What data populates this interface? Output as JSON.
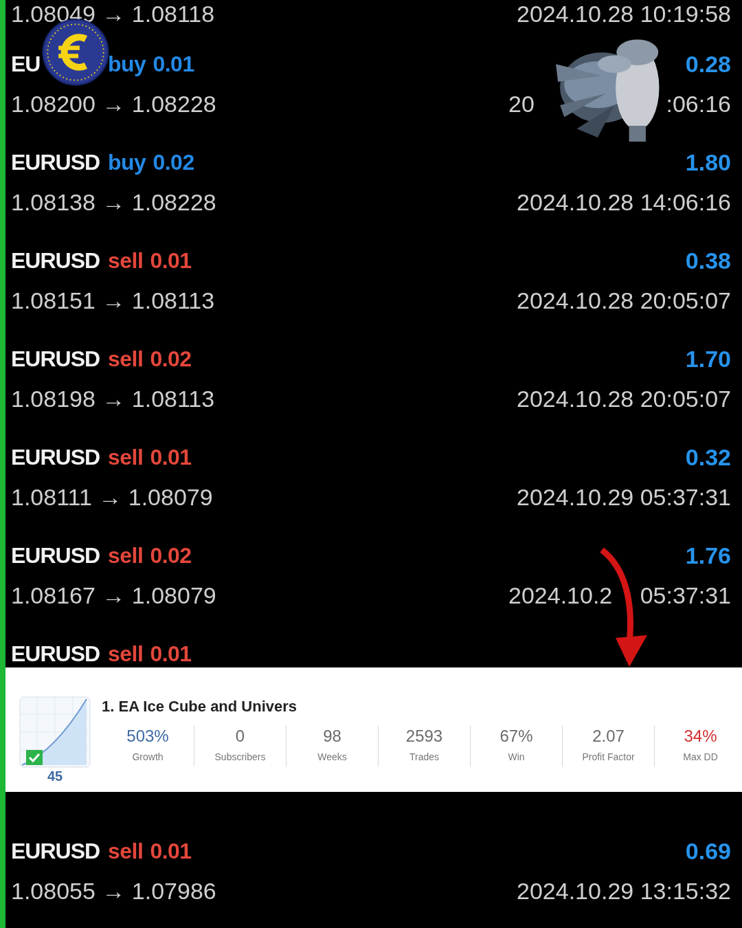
{
  "trades": [
    {
      "prices": "1.08049 → 1.08118",
      "time": [
        "2024.10.28 10:19:58"
      ]
    },
    {
      "symbol": "EU",
      "side": "buy",
      "lot": "0.01",
      "profit": "0.28",
      "prices": "1.08200 → 1.08228",
      "time": [
        "20",
        ":06:16"
      ]
    },
    {
      "symbol": "EURUSD",
      "side": "buy",
      "lot": "0.02",
      "profit": "1.80",
      "prices": "1.08138 → 1.08228",
      "time": [
        "2024.10.28 14:06:16"
      ]
    },
    {
      "symbol": "EURUSD",
      "side": "sell",
      "lot": "0.01",
      "profit": "0.38",
      "prices": "1.08151 → 1.08113",
      "time": [
        "2024.10.28 20:05:07"
      ]
    },
    {
      "symbol": "EURUSD",
      "side": "sell",
      "lot": "0.02",
      "profit": "1.70",
      "prices": "1.08198 → 1.08113",
      "time": [
        "2024.10.28 20:05:07"
      ]
    },
    {
      "symbol": "EURUSD",
      "side": "sell",
      "lot": "0.01",
      "profit": "0.32",
      "prices": "1.08111 → 1.08079",
      "time": [
        "2024.10.29 05:37:31"
      ]
    },
    {
      "symbol": "EURUSD",
      "side": "sell",
      "lot": "0.02",
      "profit": "1.76",
      "prices": "1.08167 → 1.08079",
      "time": [
        "2024.10.2",
        "05:37:31"
      ]
    },
    {
      "symbol": "EURUSD",
      "side": "sell",
      "lot": "0.01"
    }
  ],
  "trades_below": [
    {
      "symbol": "EURUSD",
      "side": "sell",
      "lot": "0.01",
      "profit": "0.69",
      "prices": "1.08055 → 1.07986",
      "time": [
        "2024.10.29 13:15:32"
      ]
    }
  ],
  "signal_card": {
    "title": "1. EA Ice Cube and Univers",
    "rank": "45",
    "verified": true,
    "stats": [
      {
        "value": "503%",
        "label": "Growth",
        "color": "#3d6aa3"
      },
      {
        "value": "0",
        "label": "Subscribers",
        "color": "#6b6b6b"
      },
      {
        "value": "98",
        "label": "Weeks",
        "color": "#6b6b6b"
      },
      {
        "value": "2593",
        "label": "Trades",
        "color": "#6b6b6b"
      },
      {
        "value": "67%",
        "label": "Win",
        "color": "#6b6b6b"
      },
      {
        "value": "2.07",
        "label": "Profit Factor",
        "color": "#6b6b6b"
      },
      {
        "value": "34%",
        "label": "Max DD",
        "color": "#d3302f"
      }
    ]
  }
}
